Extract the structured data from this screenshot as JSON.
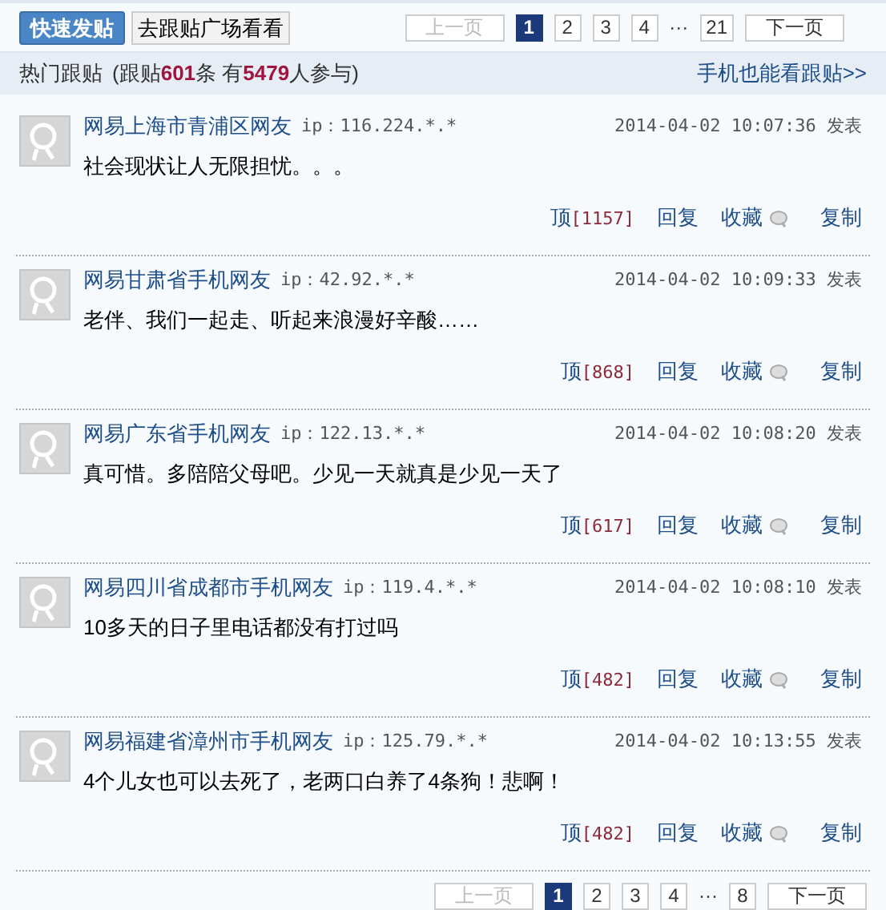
{
  "toolbar": {
    "post_button": "快速发贴",
    "plaza_link": "去跟贴广场看看"
  },
  "top_pagination": {
    "prev": "上一页",
    "next": "下一页",
    "ellipsis": "···",
    "pages": [
      {
        "label": "1",
        "selected": true
      },
      {
        "label": "2",
        "selected": false
      },
      {
        "label": "3",
        "selected": false
      },
      {
        "label": "4",
        "selected": false
      },
      {
        "label": "21",
        "selected": false
      }
    ]
  },
  "header": {
    "title": "热门跟贴",
    "summary": "(跟贴**601**条 有**5479**人参与)",
    "mobile_link": "手机也能看跟贴>>"
  },
  "posts": [
    {
      "author": "网易上海市青浦区网友",
      "ip": "ip：116.224.*.*",
      "time": "2014-04-02 10:07:36 发表",
      "text": "社会现状让人无限担忧。。。",
      "up_label": "顶",
      "up_count": "[1157]",
      "reply": "回复",
      "favorite": "收藏",
      "copy": "复制"
    },
    {
      "author": "网易甘肃省手机网友",
      "ip": "ip：42.92.*.*",
      "time": "2014-04-02 10:09:33 发表",
      "text": "老伴、我们一起走、听起来浪漫好辛酸……",
      "up_label": "顶",
      "up_count": "[868]",
      "reply": "回复",
      "favorite": "收藏",
      "copy": "复制"
    },
    {
      "author": "网易广东省手机网友",
      "ip": "ip：122.13.*.*",
      "time": "2014-04-02 10:08:20 发表",
      "text": "真可惜。多陪陪父母吧。少见一天就真是少见一天了",
      "up_label": "顶",
      "up_count": "[617]",
      "reply": "回复",
      "favorite": "收藏",
      "copy": "复制"
    },
    {
      "author": "网易四川省成都市手机网友",
      "ip": "ip：119.4.*.*",
      "time": "2014-04-02 10:08:10 发表",
      "text": "10多天的日子里电话都没有打过吗",
      "up_label": "顶",
      "up_count": "[482]",
      "reply": "回复",
      "favorite": "收藏",
      "copy": "复制"
    },
    {
      "author": "网易福建省漳州市手机网友",
      "ip": "ip：125.79.*.*",
      "time": "2014-04-02 10:13:55 发表",
      "text": "4个儿女也可以去死了，老两口白养了4条狗！悲啊！",
      "up_label": "顶",
      "up_count": "[482]",
      "reply": "回复",
      "favorite": "收藏",
      "copy": "复制"
    }
  ],
  "bottom_pagination": {
    "prev": "上一页",
    "next": "下一页",
    "ellipsis": "···",
    "pages": [
      {
        "label": "1",
        "selected": true
      },
      {
        "label": "2",
        "selected": false
      },
      {
        "label": "3",
        "selected": false
      },
      {
        "label": "4",
        "selected": false
      },
      {
        "label": "8",
        "selected": false
      }
    ]
  }
}
